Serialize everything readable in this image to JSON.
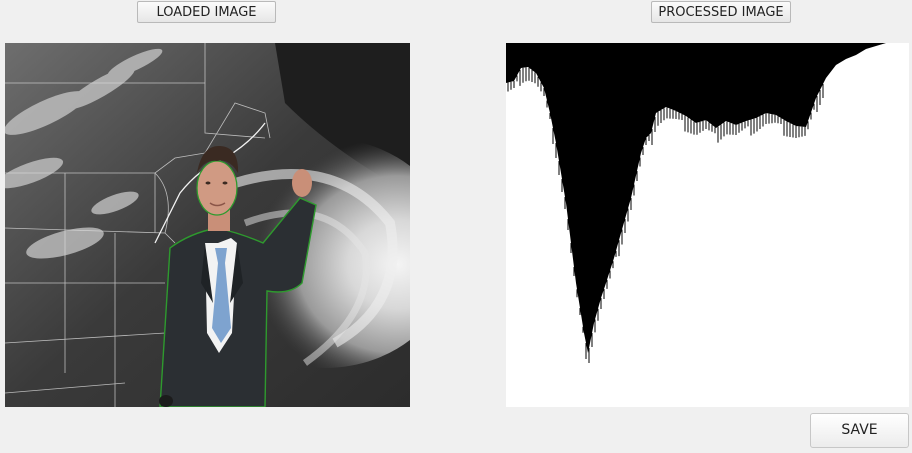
{
  "buttons": {
    "loaded_image": "LOADED IMAGE",
    "processed_image": "PROCESSED IMAGE",
    "save": "SAVE"
  },
  "icons": {
    "loaded_image": "weather-map-presenter-photo",
    "processed_image": "binary-silhouette-profile"
  },
  "colors": {
    "window_bg": "#f0f0f0",
    "profile_fill": "#000000",
    "profile_bg": "#ffffff",
    "segment_outline": "#2e9a2e"
  }
}
